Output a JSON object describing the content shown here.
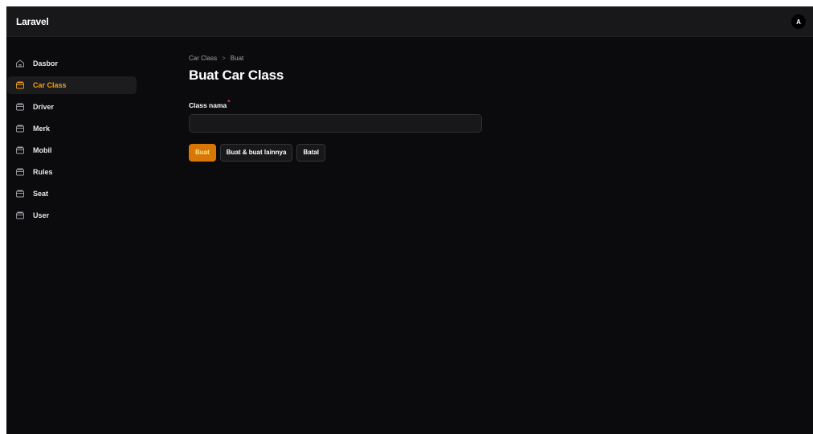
{
  "app": {
    "brand": "Laravel",
    "avatar_initial": "A"
  },
  "colors": {
    "accent": "#f59e0b",
    "primary_button": "#d97706",
    "background": "#0b0b0d",
    "required": "#ef4444"
  },
  "sidebar": {
    "items": [
      {
        "label": "Dasbor",
        "icon": "home-icon",
        "active": false
      },
      {
        "label": "Car Class",
        "icon": "folder-icon",
        "active": true
      },
      {
        "label": "Driver",
        "icon": "folder-icon",
        "active": false
      },
      {
        "label": "Merk",
        "icon": "folder-icon",
        "active": false
      },
      {
        "label": "Mobil",
        "icon": "folder-icon",
        "active": false
      },
      {
        "label": "Rules",
        "icon": "folder-icon",
        "active": false
      },
      {
        "label": "Seat",
        "icon": "folder-icon",
        "active": false
      },
      {
        "label": "User",
        "icon": "folder-icon",
        "active": false
      }
    ]
  },
  "breadcrumb": {
    "parent": "Car Class",
    "separator": ">",
    "current": "Buat"
  },
  "page": {
    "title": "Buat Car Class"
  },
  "form": {
    "class_nama": {
      "label": "Class nama",
      "required_mark": "*",
      "value": "",
      "placeholder": ""
    }
  },
  "actions": {
    "create": "Buat",
    "create_another": "Buat & buat lainnya",
    "cancel": "Batal"
  }
}
